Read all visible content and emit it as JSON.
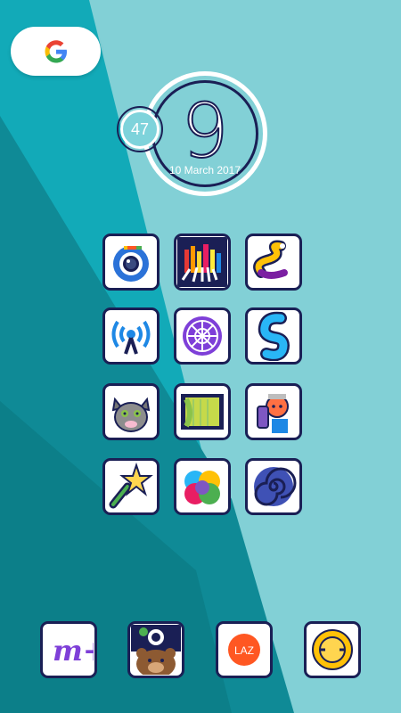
{
  "clock_widget": {
    "hour": "9",
    "battery": "47",
    "date": "10 March 2017"
  },
  "google_widget": {
    "logo_letter": "G"
  },
  "grid_icons": [
    {
      "name": "camera-eye-icon"
    },
    {
      "name": "brushes-icon"
    },
    {
      "name": "snake-icon"
    },
    {
      "name": "wifi-tower-icon"
    },
    {
      "name": "mesh-ball-icon"
    },
    {
      "name": "s-shape-icon"
    },
    {
      "name": "talking-cat-icon"
    },
    {
      "name": "book-icon"
    },
    {
      "name": "spray-cat-icon"
    },
    {
      "name": "star-wand-icon"
    },
    {
      "name": "color-balloons-icon"
    },
    {
      "name": "spiral-icon"
    }
  ],
  "dock": [
    {
      "name": "m-plus-icon",
      "label": "m+"
    },
    {
      "name": "bear-camera-icon"
    },
    {
      "name": "laz-icon",
      "label": "LAZ"
    },
    {
      "name": "smile-circle-icon"
    }
  ],
  "colors": {
    "navy": "#1a1f55",
    "teal_dark": "#0e8793",
    "teal_mid": "#13a9b7",
    "teal_light": "#82d0d6",
    "orange": "#ff5722"
  }
}
